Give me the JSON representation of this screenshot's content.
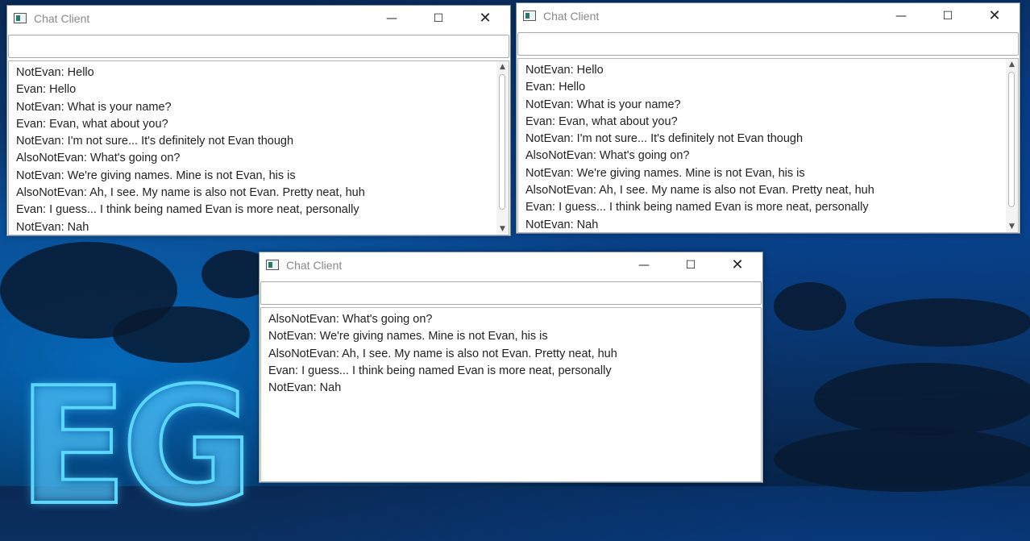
{
  "windows": [
    {
      "title": "Chat Client",
      "input_value": "",
      "messages": [
        "NotEvan: Hello",
        "Evan: Hello",
        "NotEvan: What is your name?",
        "Evan: Evan, what about you?",
        "NotEvan: I'm not sure... It's definitely not Evan though",
        "AlsoNotEvan: What's going on?",
        "NotEvan: We're giving names. Mine is not Evan, his is",
        "AlsoNotEvan: Ah, I see. My name is also not Evan. Pretty neat, huh",
        "Evan: I guess... I think being named Evan is more neat, personally",
        "NotEvan: Nah"
      ]
    },
    {
      "title": "Chat Client",
      "input_value": "",
      "messages": [
        "NotEvan: Hello",
        "Evan: Hello",
        "NotEvan: What is your name?",
        "Evan: Evan, what about you?",
        "NotEvan: I'm not sure... It's definitely not Evan though",
        "AlsoNotEvan: What's going on?",
        "NotEvan: We're giving names. Mine is not Evan, his is",
        "AlsoNotEvan: Ah, I see. My name is also not Evan. Pretty neat, huh",
        "Evan: I guess... I think being named Evan is more neat, personally",
        "NotEvan: Nah"
      ]
    },
    {
      "title": "Chat Client",
      "input_value": "",
      "messages": [
        "AlsoNotEvan: What's going on?",
        "NotEvan: We're giving names. Mine is not Evan, his is",
        "AlsoNotEvan: Ah, I see. My name is also not Evan. Pretty neat, huh",
        "Evan: I guess... I think being named Evan is more neat, personally",
        "NotEvan: Nah"
      ]
    }
  ],
  "controls": {
    "minimize": "—",
    "maximize": "☐",
    "close": "✕"
  },
  "scroll_icons": {
    "up": "▲",
    "down": "▼"
  },
  "wallpaper": {
    "logo_text": "EG"
  },
  "colors": {
    "title_text": "#888888",
    "desktop_glow": "#5ad7ff"
  }
}
